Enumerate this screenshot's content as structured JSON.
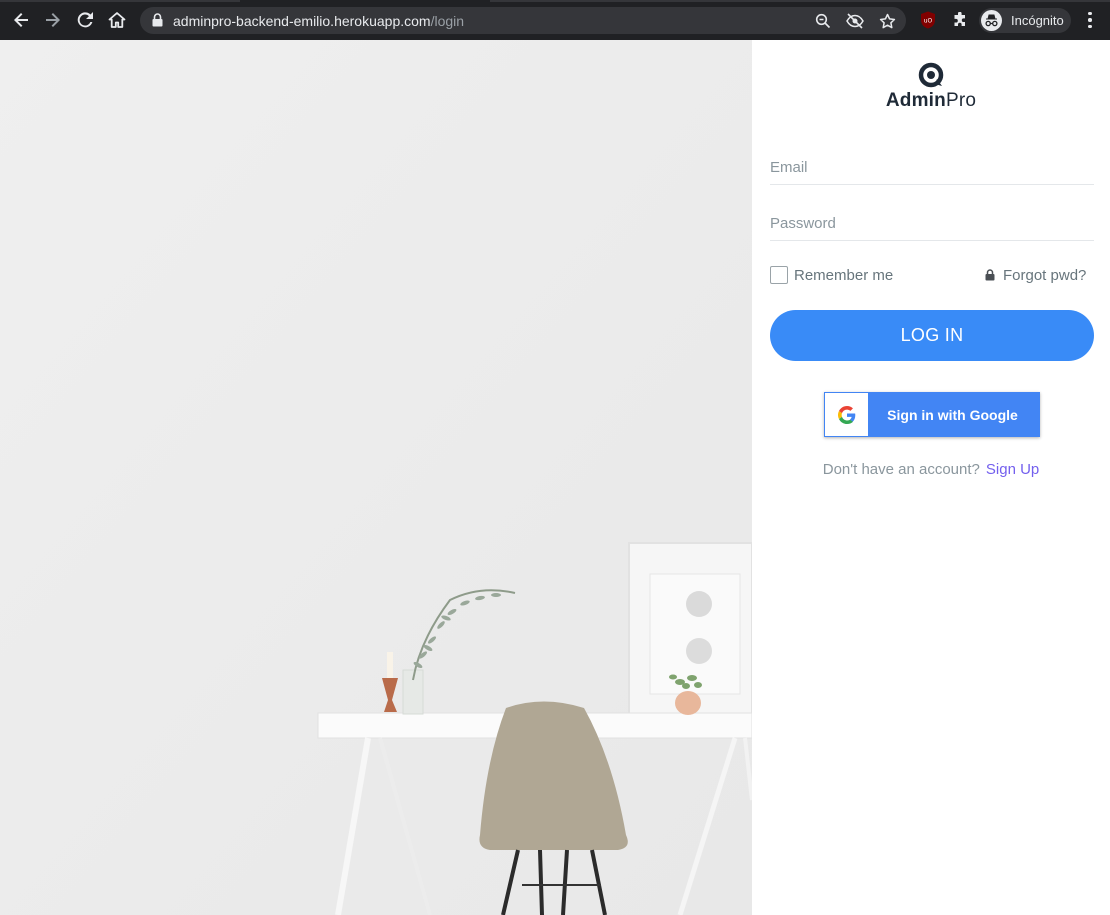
{
  "browser": {
    "url_host": "adminpro-backend-emilio.herokuapp.com",
    "url_path": "/login",
    "profile_label": "Incógnito",
    "icons": [
      "back-arrow-icon",
      "forward-arrow-icon",
      "reload-icon",
      "home-icon",
      "lock-icon",
      "zoom-icon",
      "tracking-blocked-icon",
      "bookmark-star-icon",
      "ublock-icon",
      "extensions-puzzle-icon",
      "incognito-icon",
      "menu-dots-icon"
    ]
  },
  "brand": {
    "name_bold": "Admin",
    "name_regular": "Pro"
  },
  "form": {
    "email_placeholder": "Email",
    "password_placeholder": "Password",
    "remember_label": "Remember me",
    "forgot_label": "Forgot pwd?",
    "login_label": "LOG IN",
    "google_label": "Sign in with Google",
    "no_account_text": "Don't have an account?",
    "signup_label": "Sign Up"
  },
  "colors": {
    "primary": "#398bf7",
    "google_blue": "#4285f4",
    "link_purple": "#7460ee",
    "text_muted": "#67757c"
  }
}
